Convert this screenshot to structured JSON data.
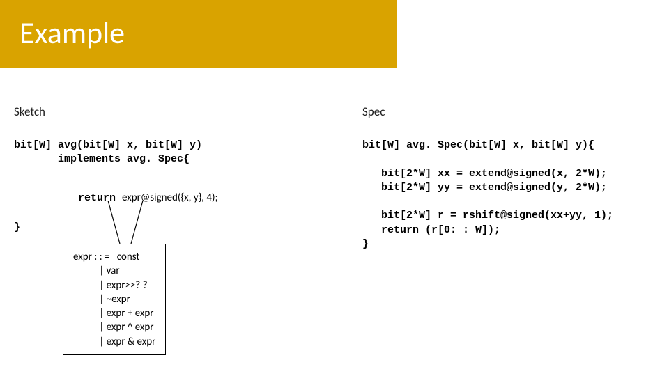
{
  "title": "Example",
  "labels": {
    "sketch": "Sketch",
    "spec": "Spec"
  },
  "sketch": {
    "sig": "bit[W] avg(bit[W] x, bit[W] y)\n       implements avg. Spec{",
    "ret_kw": "return",
    "ret_expr": "expr@signed({x, y}, 4);",
    "close": "}"
  },
  "grammar": "expr : : =   const\n           | var\n           | expr>>? ?\n           | ~expr\n           | expr + expr\n           | expr ^ expr\n           | expr & expr",
  "spec_code": "bit[W] avg. Spec(bit[W] x, bit[W] y){\n\n   bit[2*W] xx = extend@signed(x, 2*W);\n   bit[2*W] yy = extend@signed(y, 2*W);\n\n   bit[2*W] r = rshift@signed(xx+yy, 1);\n   return (r[0: : W]);\n}"
}
